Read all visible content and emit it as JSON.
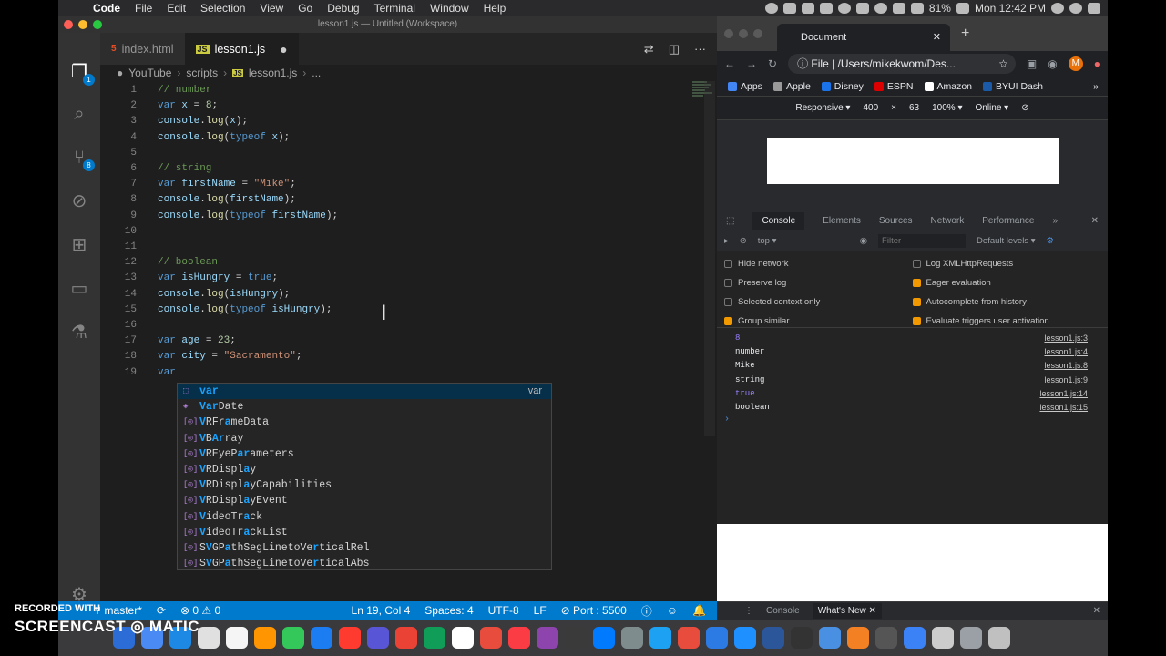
{
  "menubar": {
    "app_name": "Code",
    "items": [
      "File",
      "Edit",
      "Selection",
      "View",
      "Go",
      "Debug",
      "Terminal",
      "Window",
      "Help"
    ],
    "battery": "81%",
    "clock": "Mon 12:42 PM"
  },
  "vscode": {
    "window_title": "lesson1.js — Untitled (Workspace)",
    "tabs": [
      {
        "label": "index.html",
        "icon": "html-icon"
      },
      {
        "label": "lesson1.js",
        "icon": "js-icon"
      }
    ],
    "breadcrumb": [
      "YouTube",
      "scripts",
      "lesson1.js",
      "..."
    ],
    "badges": {
      "explorer": "1",
      "scm": "8"
    },
    "lines": [
      {
        "n": "1",
        "html": "<span class='cm'>// number</span>"
      },
      {
        "n": "2",
        "html": "<span class='kw'>var</span> <span class='vr'>x</span> = <span class='num'>8</span>;"
      },
      {
        "n": "3",
        "html": "<span class='vr'>console</span>.<span class='fn'>log</span>(<span class='vr'>x</span>);"
      },
      {
        "n": "4",
        "html": "<span class='vr'>console</span>.<span class='fn'>log</span>(<span class='kw'>typeof</span> <span class='vr'>x</span>);"
      },
      {
        "n": "5",
        "html": ""
      },
      {
        "n": "6",
        "html": "<span class='cm'>// string</span>"
      },
      {
        "n": "7",
        "html": "<span class='kw'>var</span> <span class='vr'>firstName</span> = <span class='str'>\"Mike\"</span>;"
      },
      {
        "n": "8",
        "html": "<span class='vr'>console</span>.<span class='fn'>log</span>(<span class='vr'>firstName</span>);"
      },
      {
        "n": "9",
        "html": "<span class='vr'>console</span>.<span class='fn'>log</span>(<span class='kw'>typeof</span> <span class='vr'>firstName</span>);"
      },
      {
        "n": "10",
        "html": ""
      },
      {
        "n": "11",
        "html": ""
      },
      {
        "n": "12",
        "html": "<span class='cm'>// boolean</span>"
      },
      {
        "n": "13",
        "html": "<span class='kw'>var</span> <span class='vr'>isHungry</span> = <span class='kw'>true</span>;"
      },
      {
        "n": "14",
        "html": "<span class='vr'>console</span>.<span class='fn'>log</span>(<span class='vr'>isHungry</span>);"
      },
      {
        "n": "15",
        "html": "<span class='vr'>console</span>.<span class='fn'>log</span>(<span class='kw'>typeof</span> <span class='vr'>isHungry</span>);"
      },
      {
        "n": "16",
        "html": ""
      },
      {
        "n": "17",
        "html": "<span class='kw'>var</span> <span class='vr'>age</span> = <span class='num'>23</span>;"
      },
      {
        "n": "18",
        "html": "<span class='kw'>var</span> <span class='vr'>city</span> = <span class='str'>\"Sacramento\"</span>;"
      },
      {
        "n": "19",
        "html": "<span class='kw'>var</span>"
      }
    ],
    "suggestions": [
      {
        "label": "var",
        "detail": "var",
        "kind": "keyword"
      },
      {
        "label": "VarDate",
        "detail": "",
        "kind": "class"
      },
      {
        "label": "VRFrameData",
        "detail": "",
        "kind": "variable"
      },
      {
        "label": "VBArray",
        "detail": "",
        "kind": "variable"
      },
      {
        "label": "VREyeParameters",
        "detail": "",
        "kind": "variable"
      },
      {
        "label": "VRDisplay",
        "detail": "",
        "kind": "variable"
      },
      {
        "label": "VRDisplayCapabilities",
        "detail": "",
        "kind": "variable"
      },
      {
        "label": "VRDisplayEvent",
        "detail": "",
        "kind": "variable"
      },
      {
        "label": "VideoTrack",
        "detail": "",
        "kind": "variable"
      },
      {
        "label": "VideoTrackList",
        "detail": "",
        "kind": "variable"
      },
      {
        "label": "SVGPathSegLinetoVerticalRel",
        "detail": "",
        "kind": "variable"
      },
      {
        "label": "SVGPathSegLinetoVerticalAbs",
        "detail": "",
        "kind": "variable"
      }
    ],
    "status": {
      "branch": "master*",
      "errors": "0",
      "warnings": "0",
      "position": "Ln 19, Col 4",
      "spaces": "Spaces: 4",
      "encoding": "UTF-8",
      "eol": "LF",
      "port": "Port : 5500"
    }
  },
  "chrome": {
    "tab_title": "Document",
    "url_prefix": "File",
    "url": "/Users/mikekwom/Des...",
    "avatar_letter": "M",
    "bookmarks": [
      "Apps",
      "Apple",
      "Disney",
      "ESPN",
      "Amazon",
      "BYUI Dash"
    ],
    "device": {
      "mode": "Responsive",
      "width": "400",
      "times": "×",
      "height": "63",
      "zoom": "100%",
      "network": "Online"
    },
    "devtools_tabs": [
      "Console",
      "Elements",
      "Sources",
      "Network",
      "Performance"
    ],
    "context": "top",
    "filter_placeholder": "Filter",
    "levels": "Default levels",
    "settings_left": [
      {
        "label": "Hide network",
        "checked": false
      },
      {
        "label": "Preserve log",
        "checked": false
      },
      {
        "label": "Selected context only",
        "checked": false
      },
      {
        "label": "Group similar",
        "checked": true
      }
    ],
    "settings_right": [
      {
        "label": "Log XMLHttpRequests",
        "checked": false
      },
      {
        "label": "Eager evaluation",
        "checked": true
      },
      {
        "label": "Autocomplete from history",
        "checked": true
      },
      {
        "label": "Evaluate triggers user activation",
        "checked": true
      }
    ],
    "console_lines": [
      {
        "value": "8",
        "source": "lesson1.js:3",
        "kind": "number"
      },
      {
        "value": "number",
        "source": "lesson1.js:4",
        "kind": "text"
      },
      {
        "value": "Mike",
        "source": "lesson1.js:8",
        "kind": "text"
      },
      {
        "value": "string",
        "source": "lesson1.js:9",
        "kind": "text"
      },
      {
        "value": "true",
        "source": "lesson1.js:14",
        "kind": "bool"
      },
      {
        "value": "boolean",
        "source": "lesson1.js:15",
        "kind": "text"
      }
    ],
    "drawer_tabs": [
      "Console",
      "What's New"
    ]
  },
  "watermark": {
    "line1": "RECORDED WITH",
    "line2": "SCREENCAST",
    "line3": "MATIC"
  }
}
